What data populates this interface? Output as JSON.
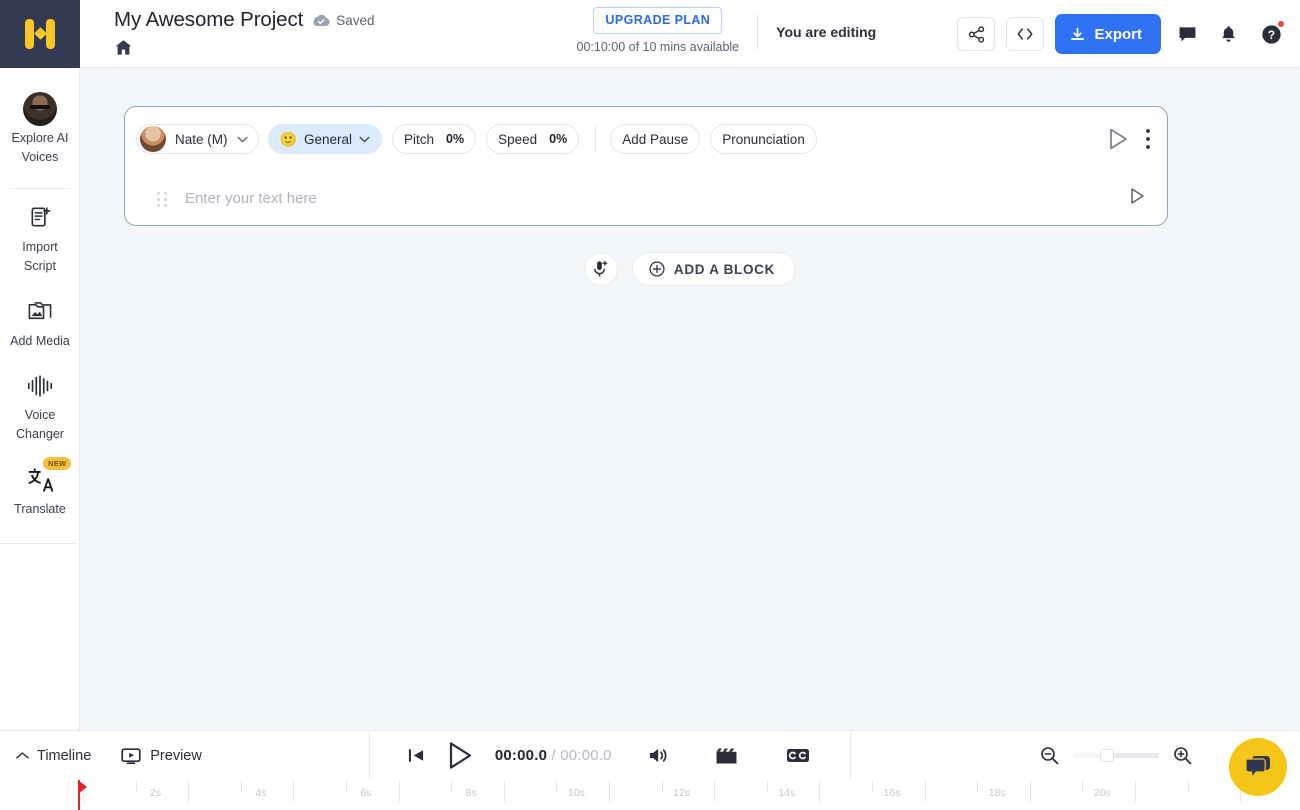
{
  "header": {
    "logo_icon": "voice-logo-icon",
    "project_title": "My Awesome Project",
    "saved_label": "Saved",
    "saved_icon": "cloud-check-icon",
    "home_icon": "home-icon",
    "upgrade_label": "UPGRADE PLAN",
    "plan_sub": "00:10:00 of 10 mins available",
    "editing_label": "You are editing",
    "share_icon": "share-icon",
    "embed_icon": "code-brackets-icon",
    "export_label": "Export",
    "export_icon": "download-icon",
    "chat_icon": "comment-icon",
    "bell_icon": "bell-icon",
    "help_icon": "help-circle-icon",
    "accent_blue": "#2f72f5",
    "logo_bg": "#343a52",
    "logo_yellow": "#f8c924"
  },
  "sidebar": {
    "items": [
      {
        "label": "Explore AI\nVoices",
        "icon": "avatar-portrait-icon",
        "badge": ""
      },
      {
        "label": "Import\nScript",
        "icon": "import-script-icon",
        "badge": ""
      },
      {
        "label": "Add Media",
        "icon": "add-media-icon",
        "badge": ""
      },
      {
        "label": "Voice\nChanger",
        "icon": "waveform-icon",
        "badge": ""
      },
      {
        "label": "Translate",
        "icon": "translate-icon",
        "badge": "NEW"
      }
    ]
  },
  "editor": {
    "block": {
      "voice_name": "Nate (M)",
      "voice_avatar_icon": "voice-avatar-icon",
      "voice_caret_icon": "chevron-down-icon",
      "style_label": "General",
      "style_emoji": "🙂",
      "style_caret_icon": "chevron-down-icon",
      "pitch_label": "Pitch",
      "pitch_value": "0%",
      "speed_label": "Speed",
      "speed_value": "0%",
      "add_pause_label": "Add Pause",
      "pronunciation_label": "Pronunciation",
      "play_icon": "play-outline-icon",
      "more_icon": "more-vertical-icon",
      "text_placeholder": "Enter your text here",
      "text_value": "",
      "drag_handle_icon": "drag-handle-icon",
      "inner_play_icon": "play-outline-icon",
      "border_color": "#8ba9c6"
    },
    "mic_icon": "mic-plus-icon",
    "add_block_label": "ADD A BLOCK",
    "add_block_icon": "plus-circle-icon"
  },
  "bottom_bar": {
    "timeline_label": "Timeline",
    "timeline_caret_icon": "chevron-up-icon",
    "preview_label": "Preview",
    "preview_icon": "preview-screen-icon",
    "skip_start_icon": "skip-to-start-icon",
    "play_icon": "play-outline-icon",
    "current_time": "00:00.0",
    "time_separator": "/",
    "total_time": "00:00.0",
    "volume_icon": "volume-icon",
    "clapper_icon": "clapperboard-icon",
    "captions_icon": "closed-captions-icon",
    "zoom_out_icon": "zoom-out-icon",
    "zoom_in_icon": "zoom-in-icon",
    "zoom_slider_value": 33
  },
  "timeline": {
    "tick_labels": [
      "2s",
      "4s",
      "6s",
      "8s",
      "10s",
      "12s",
      "14s",
      "16s",
      "18s",
      "20s"
    ],
    "playhead_position_seconds": 0,
    "playhead_color": "#e8212b"
  },
  "chat_fab": {
    "icon": "chat-bubbles-icon",
    "color": "#f5c518"
  }
}
